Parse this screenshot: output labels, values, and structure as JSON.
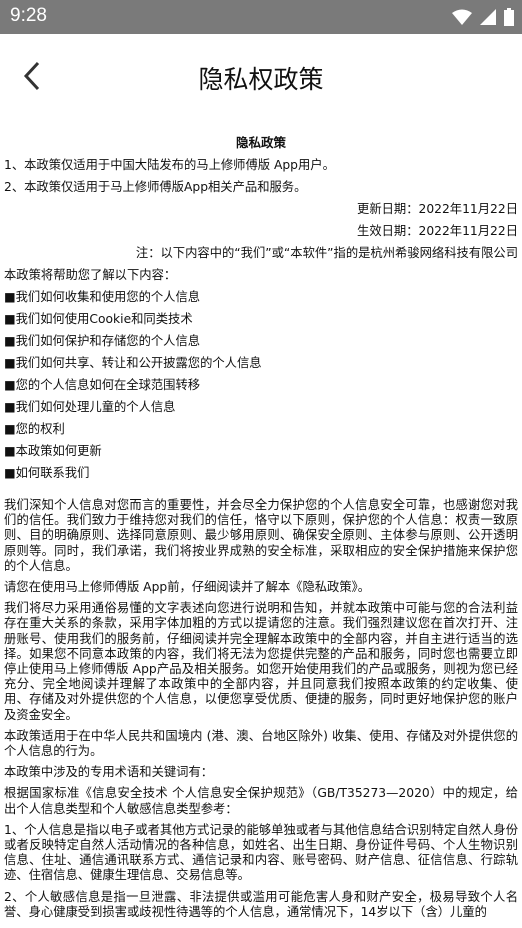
{
  "status_bar": {
    "time": "9:28",
    "icons": [
      "wifi-icon",
      "signal-icon",
      "battery-icon"
    ]
  },
  "header": {
    "title": "隐私权政策",
    "back_icon": "chevron-left-icon"
  },
  "content": {
    "title": "隐私政策",
    "intro": [
      "1、本政策仅适用于中国大陆发布的马上修师傅版 App用户。",
      "2、本政策仅适用于马上修师傅版App相关产品和服务。"
    ],
    "update_date": "更新日期：2022年11月22日",
    "effective_date": "生效日期：2022年11月22日",
    "note": "注：以下内容中的“我们”或“本软件”指的是杭州希骏网络科技有限公司",
    "toc_heading": "本政策将帮助您了解以下内容：",
    "toc": [
      "■我们如何收集和使用您的个人信息",
      "■我们如何使用Cookie和同类技术",
      "■我们如何保护和存储您的个人信息",
      "■我们如何共享、转让和公开披露您的个人信息",
      "■您的个人信息如何在全球范围转移",
      "■我们如何处理儿童的个人信息",
      "■您的权利",
      "■本政策如何更新",
      "■如何联系我们"
    ],
    "paragraphs": [
      "我们深知个人信息对您而言的重要性，并会尽全力保护您的个人信息安全可靠，也感谢您对我们的信任。我们致力于维持您对我们的信任，恪守以下原则，保护您的个人信息：权责一致原则、目的明确原则、选择同意原则、最少够用原则、确保安全原则、主体参与原则、公开透明原则等。同时，我们承诺，我们将按业界成熟的安全标准，采取相应的安全保护措施来保护您的个人信息。",
      "请您在使用马上修师傅版 App前，仔细阅读并了解本《隐私政策》。",
      "我们将尽力采用通俗易懂的文字表述向您进行说明和告知，并就本政策中可能与您的合法利益存在重大关系的条款，采用字体加粗的方式以提请您的注意。我们强烈建议您在首次打开、注册账号、使用我们的服务前，仔细阅读并完全理解本政策中的全部内容，并自主进行适当的选择。如果您不同意本政策的内容，我们将无法为您提供完整的产品和服务，同时您也需要立即停止使用马上修师傅版 App产品及相关服务。如您开始使用我们的产品或服务，则视为您已经充分、完全地阅读并理解了本政策中的全部内容，并且同意我们按照本政策的约定收集、使用、存储及对外提供您的个人信息，以便您享受优质、便捷的服务，同时更好地保护您的账户及资金安全。",
      "本政策适用于在中华人民共和国境内 (港、澳、台地区除外) 收集、使用、存储及对外提供您的个人信息的行为。",
      "本政策中涉及的专用术语和关键词有：",
      "根据国家标准《信息安全技术 个人信息安全保护规范》（GB/T35273—2020）中的规定，给出个人信息类型和个人敏感信息类型参考：",
      "1、个人信息是指以电子或者其他方式记录的能够单独或者与其他信息结合识别特定自然人身份或者反映特定自然人活动情况的各种信息，如姓名、出生日期、身份证件号码、个人生物识别信息、住址、通信通讯联系方式、通信记录和内容、账号密码、财产信息、征信信息、行踪轨迹、住宿信息、健康生理信息、交易信息等。",
      "2、个人敏感信息是指一旦泄露、非法提供或滥用可能危害人身和财产安全，极易导致个人名誉、身心健康受到损害或歧视性待遇等的个人信息，通常情况下，14岁以下（含）儿童的"
    ]
  }
}
